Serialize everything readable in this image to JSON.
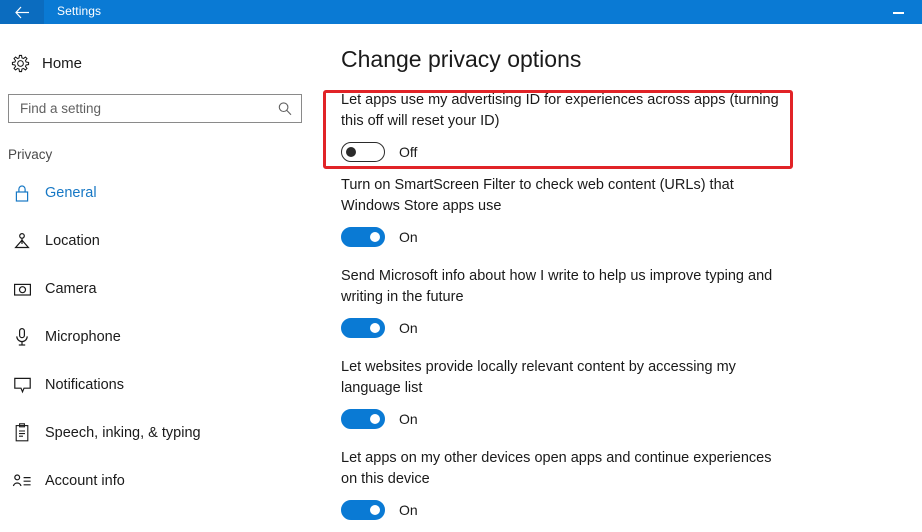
{
  "window": {
    "title": "Settings",
    "back_icon": "back-arrow-icon",
    "minimize_label": "—",
    "titlebar_color": "#0a7ad4"
  },
  "sidebar": {
    "home": {
      "label": "Home",
      "icon": "gear-icon"
    },
    "search": {
      "placeholder": "Find a setting",
      "value": "",
      "icon": "search-icon"
    },
    "section_title": "Privacy",
    "items": [
      {
        "label": "General",
        "icon": "lock-icon",
        "selected": true
      },
      {
        "label": "Location",
        "icon": "location-icon",
        "selected": false
      },
      {
        "label": "Camera",
        "icon": "camera-icon",
        "selected": false
      },
      {
        "label": "Microphone",
        "icon": "microphone-icon",
        "selected": false
      },
      {
        "label": "Notifications",
        "icon": "notification-bubble-icon",
        "selected": false
      },
      {
        "label": "Speech, inking, & typing",
        "icon": "clipboard-icon",
        "selected": false
      },
      {
        "label": "Account info",
        "icon": "account-info-icon",
        "selected": false
      }
    ]
  },
  "main": {
    "heading": "Change privacy options",
    "settings": [
      {
        "label": "Let apps use my advertising ID for experiences across apps (turning this off will reset your ID)",
        "state": "Off",
        "on": false,
        "highlighted": true
      },
      {
        "label": "Turn on SmartScreen Filter to check web content (URLs) that Windows Store apps use",
        "state": "On",
        "on": true,
        "highlighted": false
      },
      {
        "label": "Send Microsoft info about how I write to help us improve typing and writing in the future",
        "state": "On",
        "on": true,
        "highlighted": false
      },
      {
        "label": "Let websites provide locally relevant content by accessing my language list",
        "state": "On",
        "on": true,
        "highlighted": false
      },
      {
        "label": "Let apps on my other devices open apps and continue experiences on this device",
        "state": "On",
        "on": true,
        "highlighted": false
      }
    ]
  },
  "annotation": {
    "highlight_color": "#e12327"
  }
}
